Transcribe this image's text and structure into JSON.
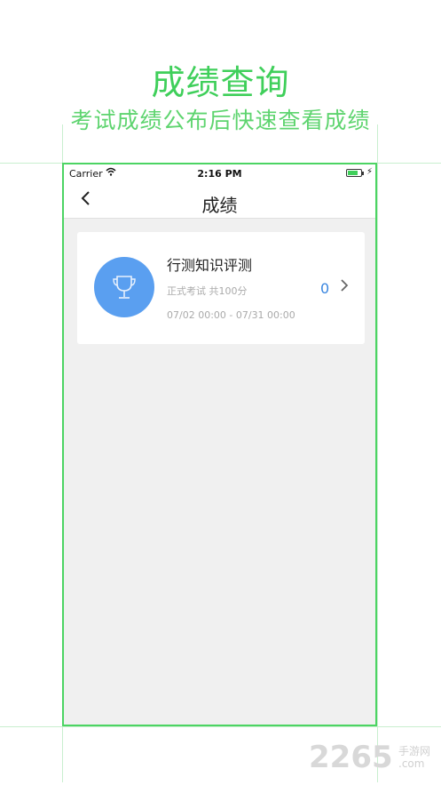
{
  "promo": {
    "title": "成绩查询",
    "subtitle": "考试成绩公布后快速查看成绩"
  },
  "status_bar": {
    "carrier": "Carrier",
    "time": "2:16 PM"
  },
  "nav": {
    "title": "成绩",
    "back_icon": "chevron-left-icon"
  },
  "exam_card": {
    "title": "行测知识评测",
    "meta": "正式考试 共100分",
    "date_range": "07/02 00:00 - 07/31 00:00",
    "score": "0",
    "icon": "trophy-icon"
  },
  "watermark": {
    "number": "2265",
    "domain": ".com",
    "name": "手游网"
  },
  "colors": {
    "accent_green": "#3fcf5a",
    "icon_blue": "#5a9ff0",
    "score_blue": "#3a86e0",
    "background": "#f0f0f0"
  }
}
